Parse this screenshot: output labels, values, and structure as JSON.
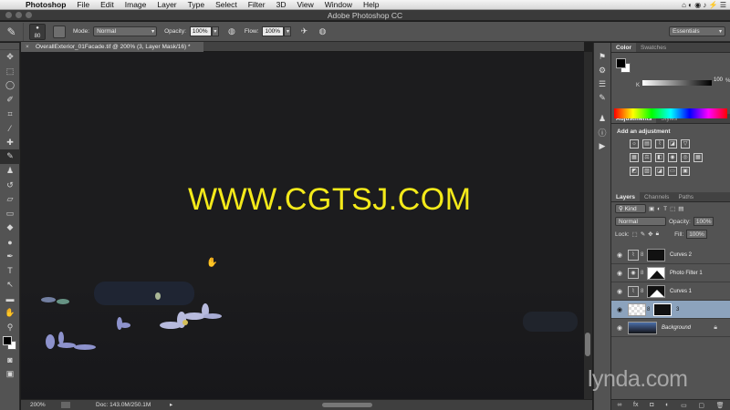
{
  "menubar": {
    "app": "Photoshop",
    "items": [
      "File",
      "Edit",
      "Image",
      "Layer",
      "Type",
      "Select",
      "Filter",
      "3D",
      "View",
      "Window",
      "Help"
    ],
    "status_icons": "⌂ ◐ ◉ ♪ ⚡ ☰"
  },
  "window": {
    "title": "Adobe Photoshop CC"
  },
  "options": {
    "brush_size": "80",
    "mode_label": "Mode:",
    "mode_value": "Normal",
    "opacity_label": "Opacity:",
    "opacity_value": "100%",
    "flow_label": "Flow:",
    "flow_value": "100%",
    "workspace": "Essentials"
  },
  "document": {
    "tab_title": "OverallExterior_01Facade.tif @ 200% (3, Layer Mask/16) *",
    "zoom": "200%",
    "doc_size": "Doc: 143.0M/250.1M"
  },
  "watermark": "WWW.CGTSJ.COM",
  "color_panel": {
    "tabs": [
      "Color",
      "Swatches"
    ],
    "k_label": "K",
    "k_value": "100",
    "pct": "%"
  },
  "adjustments_panel": {
    "tabs": [
      "Adjustments",
      "Styles"
    ],
    "title": "Add an adjustment"
  },
  "layers_panel": {
    "tabs": [
      "Layers",
      "Channels",
      "Paths"
    ],
    "filter": "Kind",
    "blend_mode": "Normal",
    "opacity_label": "Opacity:",
    "opacity_value": "100%",
    "lock_label": "Lock:",
    "fill_label": "Fill:",
    "fill_value": "100%",
    "layers": [
      {
        "name": "Curves 2",
        "type": "curves",
        "selected": false
      },
      {
        "name": "Photo Filter 1",
        "type": "photo-filter",
        "selected": false
      },
      {
        "name": "Curves 1",
        "type": "curves",
        "selected": false
      },
      {
        "name": "3",
        "type": "pixel",
        "selected": true
      },
      {
        "name": "Background",
        "type": "background",
        "selected": false
      }
    ]
  },
  "branding": {
    "logo": "lynda.com"
  }
}
